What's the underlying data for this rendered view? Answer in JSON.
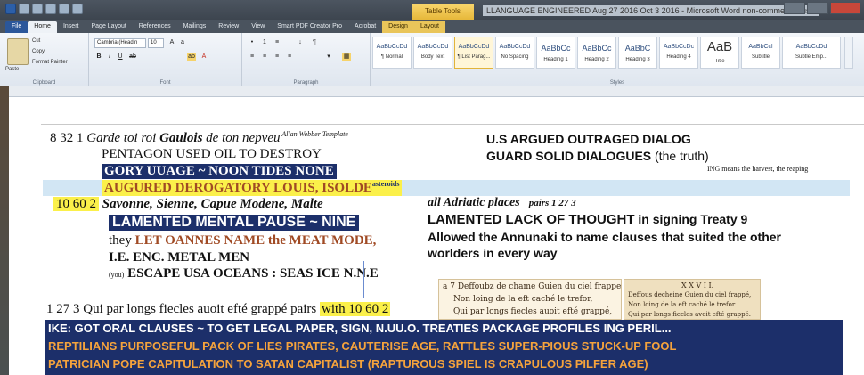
{
  "titlebar": {
    "contextual_label": "Table Tools",
    "doc_title": "LLANGUAGE ENGINEERED  Aug 27 2016 Oct 3 2016  -  Microsoft Word non-commercial use"
  },
  "tabs": [
    "File",
    "Home",
    "Insert",
    "Page Layout",
    "References",
    "Mailings",
    "Review",
    "View",
    "Smart PDF Creator Pro",
    "Acrobat",
    "Design",
    "Layout"
  ],
  "ribbon": {
    "clipboard": {
      "paste": "Paste",
      "cut": "Cut",
      "copy": "Copy",
      "format_painter": "Format Painter",
      "label": "Clipboard"
    },
    "font": {
      "family": "Cambria (Headin",
      "size": "10",
      "label": "Font"
    },
    "paragraph": {
      "label": "Paragraph"
    },
    "styles": {
      "label": "Styles",
      "items": [
        {
          "preview": "AaBbCcDd",
          "name": "¶ Normal"
        },
        {
          "preview": "AaBbCcDd",
          "name": "Body Text"
        },
        {
          "preview": "AaBbCcDd",
          "name": "¶ List Parag..."
        },
        {
          "preview": "AaBbCcDd",
          "name": "No Spacing"
        },
        {
          "preview": "AaBbCc",
          "name": "Heading 1"
        },
        {
          "preview": "AaBbCc",
          "name": "Heading 2"
        },
        {
          "preview": "AaBbC",
          "name": "Heading 3"
        },
        {
          "preview": "AaBbCcDc",
          "name": "Heading 4"
        },
        {
          "preview": "AaB",
          "name": "Title"
        },
        {
          "preview": "AaBbCcl",
          "name": "Subtitle"
        },
        {
          "preview": "AaBbCcDd",
          "name": "Subtle Emp..."
        }
      ]
    }
  },
  "doc": {
    "l1a": "8 32 1 ",
    "l1b": "Garde toi roi ",
    "l1c": "Gaulois",
    "l1d": " de ton nepveu",
    "l1e": " Allan Webber Template",
    "l2": "PENTAGON USED OIL TO DESTROY",
    "l3": "GORY UUAGE ~ NOON TIDES NONE",
    "l4": "AUGURED DEROGATORY LOUIS, ISOLDE",
    "l4sup": "asteroids",
    "l5num": "10 60  2",
    "l5": " Savonne, Sienne, Capue Modene, Malte",
    "l6": "LAMENTED MENTAL PAUSE ~ NINE",
    "l7a": "they ",
    "l7b": "LET OANNES NAME the MEAT MODE,",
    "l8": "I.E. ENC. METAL MEN",
    "l9a": "(you)",
    "l9b": " ESCAPE USA OCEANS :  SEAS  ICE  N.N.E",
    "r1": "U.S ARGUED  OUTRAGED DIALOG",
    "r2a": "GUARD SOLID DIALOGUES",
    "r2b": " (the truth)",
    "r3": "ING  means the harvest, the reaping",
    "r4a": "all Adriatic places",
    "r4b": "pairs 1 27 3",
    "r5a": "LAMENTED LACK OF THOUGHT",
    "r5b": " in signing  Treaty 9",
    "r6": "Allowed the Annunaki to name clauses that suited the other",
    "r7": "worlders  in every way",
    "old1": "a 7 Deffoubz de chame Guien du ciel frappe,",
    "old2": "Non loing de la eft caché le trefor,",
    "old3": "Qui par longs fiecles auoit efté grappé,",
    "old4": "X X V I I.",
    "old5": "Deffous decheine Guien du ciel frappé,",
    "old6": "Non loing de la eft caché le trefor.",
    "old7": "Qui par longs fiecles avoit efté grappé.",
    "q1a": "1 27 3 Qui par longs fiecles auoit efté grappé   pairs  ",
    "q1b": "with 10  60 2",
    "b1": "IKE: GOT ORAL CLAUSES ~ TO GET LEGAL PAPER, SIGN, N.UU.O. TREATIES PACKAGE PROFILES ING PERIL...",
    "b2": "REPTILIANS PURPOSEFUL PACK OF LIES PIRATES, CAUTERISE AGE, RATTLES SUPER-PIOUS STUCK-UP FOOL",
    "b3": "PATRICIAN  POPE  CAPITULATION TO SATAN CAPITALIST (RAPTUROUS  SPIEL  IS CRAPULOUS  PILFER AGE)"
  },
  "colors": {
    "navy": "#1c2f6a",
    "yellow": "#fbf04a",
    "orange_text": "#f5a33c",
    "brown_text": "#a04a24"
  }
}
